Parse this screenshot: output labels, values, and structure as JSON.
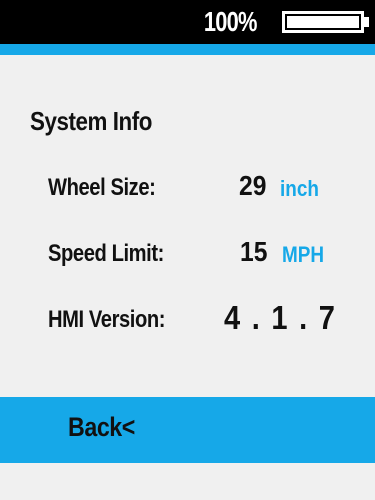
{
  "status": {
    "battery_text": "100%",
    "battery_level": 1.0
  },
  "colors": {
    "accent": "#16a8e8",
    "status_bar": "#000000",
    "background": "#f0f0f0",
    "text": "#111111"
  },
  "section": {
    "title": "System Info"
  },
  "info": {
    "wheel_size": {
      "label": "Wheel Size:",
      "value": "29",
      "unit": "inch"
    },
    "speed_limit": {
      "label": "Speed Limit:",
      "value": "15",
      "unit": "MPH"
    },
    "hmi_version": {
      "label": "HMI Version:",
      "value": "4 . 1 . 7"
    }
  },
  "back": {
    "label": "Back<"
  }
}
